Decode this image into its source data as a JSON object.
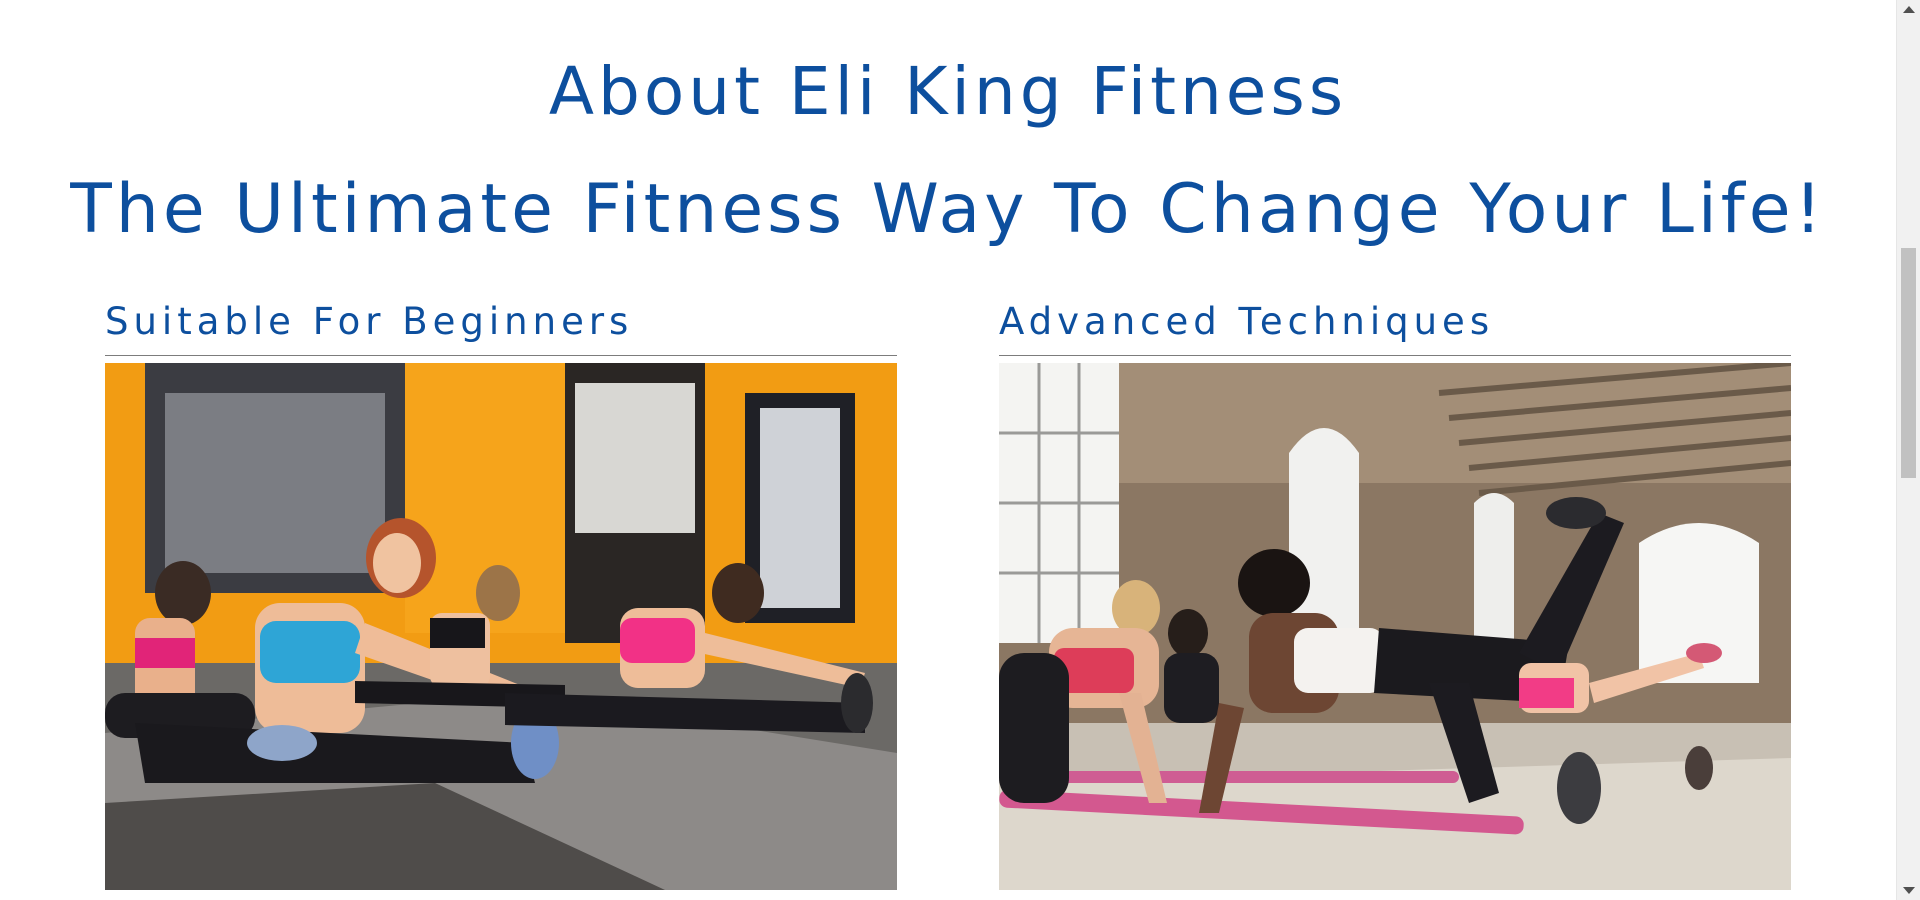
{
  "about": {
    "title": "About Eli King Fitness",
    "subtitle": "The Ultimate Fitness Way To Change Your Life!"
  },
  "cards": [
    {
      "heading": "Suitable For Beginners",
      "image_alt": "Group of women stretching on gym floor mats"
    },
    {
      "heading": "Advanced Techniques",
      "image_alt": "Group workout on pink mats in a brick loft studio"
    }
  ],
  "colors": {
    "accent": "#0d4f9e",
    "rule": "#7c7c7c"
  }
}
